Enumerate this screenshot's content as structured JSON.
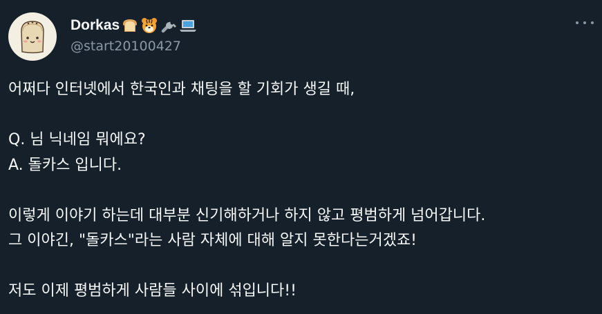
{
  "author": {
    "display_name": "Dorkas",
    "emojis": [
      "bread-emoji",
      "tiger-emoji",
      "wrench-emoji",
      "laptop-emoji"
    ],
    "handle": "@start20100427"
  },
  "menu": {
    "icon": "more-horizontal-icon"
  },
  "tweet": {
    "lines": [
      "어쩌다 인터넷에서 한국인과 채팅을 할 기회가 생길 때,",
      "",
      "Q. 님 닉네임 뭐에요?",
      "A. 돌카스 입니다.",
      "",
      "이렇게 이야기 하는데 대부분 신기해하거나 하지 않고 평범하게 넘어갑니다.",
      "그 이야긴, \"돌카스\"라는 사람 자체에 대해 알지 못한다는거겠죠!",
      "",
      "저도 이제 평범하게 사람들 사이에 섞입니다!!"
    ]
  },
  "colors": {
    "background": "#15202b",
    "text_primary": "#f7f9f9",
    "text_secondary": "#8b98a5"
  }
}
